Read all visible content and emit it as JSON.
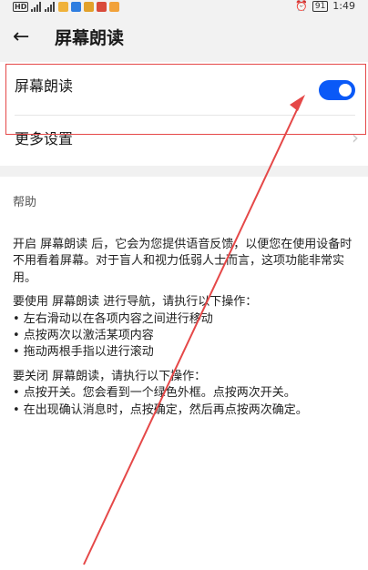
{
  "status_bar": {
    "left_badge": "HD",
    "alarm_icon": "alarm-icon",
    "battery": "91",
    "time": "1:49"
  },
  "header": {
    "back_icon": "back-arrow-icon",
    "title": "屏幕朗读"
  },
  "settings": {
    "screen_reader_label": "屏幕朗读",
    "screen_reader_on": true,
    "more_settings_label": "更多设置",
    "accent_color": "#0a59f7"
  },
  "help": {
    "heading": "帮助",
    "intro": "开启 屏幕朗读 后，它会为您提供语音反馈，以便您在使用设备时不用看着屏幕。对于盲人和视力低弱人士而言，这项功能非常实用。",
    "nav_heading": "要使用 屏幕朗读 进行导航，请执行以下操作：",
    "nav_items": [
      "• 左右滑动以在各项内容之间进行移动",
      "• 点按两次以激活某项内容",
      "• 拖动两根手指以进行滚动"
    ],
    "off_heading": "要关闭 屏幕朗读，请执行以下操作：",
    "off_items": [
      "• 点按开关。您会看到一个绿色外框。点按两次开关。",
      "• 在出现确认消息时，点按确定，然后再点按两次确定。"
    ]
  },
  "annotation": {
    "color": "#e54848"
  }
}
